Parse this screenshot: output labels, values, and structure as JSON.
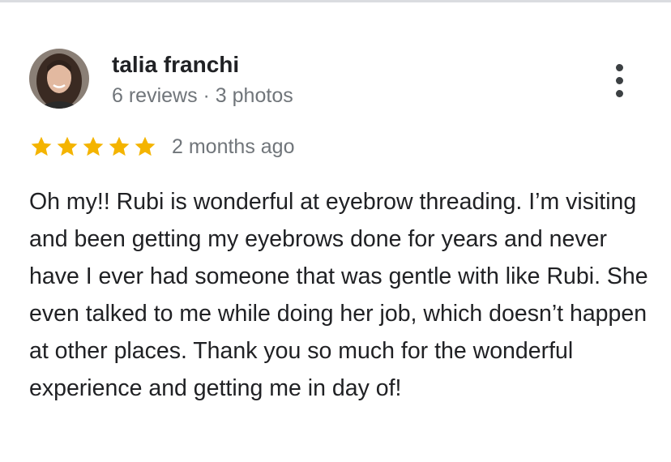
{
  "author": {
    "name": "talia franchi",
    "meta": "6 reviews · 3 photos"
  },
  "rating": {
    "stars": 5,
    "max": 5,
    "star_color": "#f4b400",
    "time_ago": "2 months ago"
  },
  "icons": {
    "more": "more-vert-icon",
    "star": "star-icon"
  },
  "review": {
    "text": "Oh my!! Rubi is wonderful at eyebrow threading. I’m visiting and been getting my eyebrows done for years and never have I ever had someone that was gentle with like Rubi. She even talked to me while doing her job, which doesn’t happen at other places. Thank you so much for the wonderful experience and getting me in day of!"
  }
}
